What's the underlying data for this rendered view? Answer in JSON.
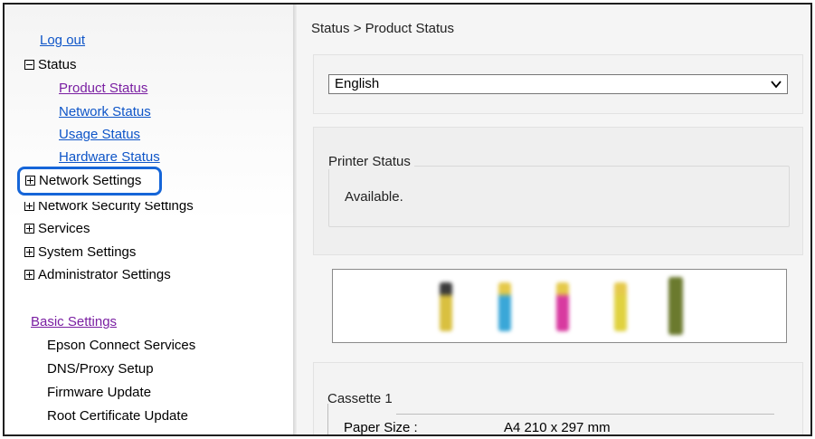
{
  "sidebar": {
    "logout": "Log out",
    "status_group": "Status",
    "status_items": [
      "Product Status",
      "Network Status",
      "Usage Status",
      "Hardware Status"
    ],
    "network_settings": "Network Settings",
    "network_security_settings": "Network Security Settings",
    "services": "Services",
    "system_settings": "System Settings",
    "administrator_settings": "Administrator Settings",
    "basic_settings": "Basic Settings",
    "basic_items": [
      "Epson Connect Services",
      "DNS/Proxy Setup",
      "Firmware Update",
      "Root Certificate Update"
    ]
  },
  "main": {
    "breadcrumb": "Status > Product Status",
    "language": {
      "selected": "English"
    },
    "printer_status": {
      "legend": "Printer Status",
      "value": "Available."
    },
    "ink_levels": [
      {
        "color": "#d9c040",
        "cap": "#3a3a3a"
      },
      {
        "color": "#3aa7d8",
        "cap": "#e5c94a"
      },
      {
        "color": "#d83aa0",
        "cap": "#e5c94a"
      },
      {
        "color": "#e0d240",
        "cap": "#e5c94a"
      },
      {
        "color": "#6b7a2e",
        "cap": "#6b7a2e"
      }
    ],
    "cassette": {
      "legend": "Cassette 1",
      "paper_size_label": "Paper Size :",
      "paper_size_value": "A4 210 x 297 mm"
    }
  },
  "colors": {
    "link": "#0e55c8",
    "visited_link": "#7a1fa2",
    "highlight": "#1565d8"
  }
}
